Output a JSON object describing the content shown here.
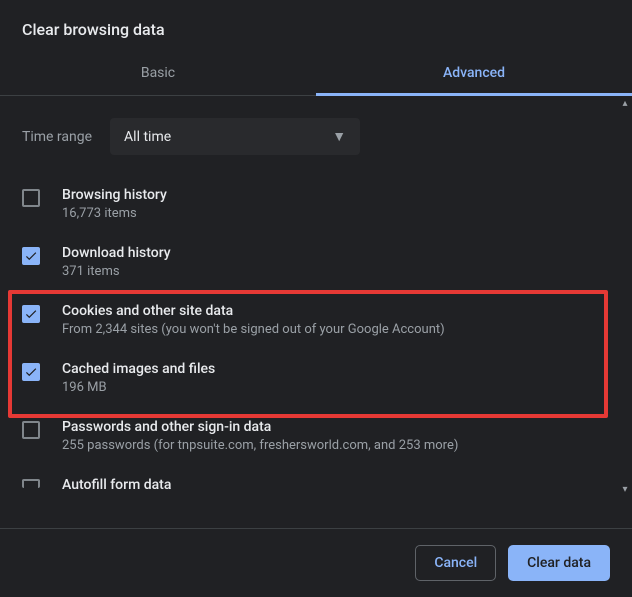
{
  "dialog": {
    "title": "Clear browsing data"
  },
  "tabs": {
    "basic": "Basic",
    "advanced": "Advanced"
  },
  "time_range": {
    "label": "Time range",
    "selected": "All time"
  },
  "options": {
    "browsing_history": {
      "title": "Browsing history",
      "sub": "16,773 items",
      "checked": false
    },
    "download_history": {
      "title": "Download history",
      "sub": "371 items",
      "checked": true
    },
    "cookies": {
      "title": "Cookies and other site data",
      "sub": "From 2,344 sites (you won't be signed out of your Google Account)",
      "checked": true
    },
    "cache": {
      "title": "Cached images and files",
      "sub": "196 MB",
      "checked": true
    },
    "passwords": {
      "title": "Passwords and other sign-in data",
      "sub": "255 passwords (for tnpsuite.com, freshersworld.com, and 253 more)",
      "checked": false
    },
    "autofill": {
      "title": "Autofill form data",
      "sub": "",
      "checked": false
    }
  },
  "footer": {
    "cancel": "Cancel",
    "clear": "Clear data"
  },
  "highlight_color": "#e53935"
}
